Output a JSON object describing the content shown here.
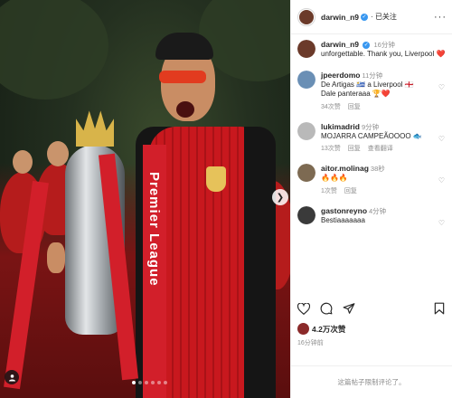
{
  "post": {
    "username": "darwin_n9",
    "follow_status": "已关注",
    "caption_time": "16分钟",
    "caption_text": "unforgettable. Thank you, Liverpool ❤️",
    "more_icon": "ellipsis-icon"
  },
  "photo": {
    "ribbon_text": "Premier League",
    "next_icon": "chevron-right-icon",
    "carousel_count": 6,
    "carousel_active": 0
  },
  "comments": [
    {
      "user": "jpeerdomo",
      "time": "11分钟",
      "text": "De Artigas 🇺🇾 a Liverpool 🏴󠁧󠁢󠁥󠁮󠁧󠁿",
      "text2": "Dale panteraaa 🏆❤️",
      "likes": "34次赞",
      "reply": "回复",
      "translate": "",
      "avatar_color": "#6a8fb5"
    },
    {
      "user": "lukimadrid",
      "time": "9分钟",
      "text": "MOJARRA CAMPEÃOOOO 🐟",
      "text2": "",
      "likes": "13次赞",
      "reply": "回复",
      "translate": "查看翻译",
      "avatar_color": "#b9b9b9"
    },
    {
      "user": "aitor.molinag",
      "time": "38秒",
      "text": "🔥🔥🔥",
      "text2": "",
      "likes": "1次赞",
      "reply": "回复",
      "translate": "",
      "avatar_color": "#7d6a52"
    },
    {
      "user": "gastonreyno",
      "time": "4分钟",
      "text": "Bestiaaaaaaa",
      "text2": "",
      "likes": "",
      "reply": "",
      "translate": "",
      "avatar_color": "#3a3a3a"
    }
  ],
  "actions": {
    "like_icon": "heart-icon",
    "comment_icon": "comment-icon",
    "share_icon": "send-icon",
    "save_icon": "bookmark-icon"
  },
  "likes_count": "4.2万次赞",
  "posted_time": "16分钟前",
  "comments_limited": "这篇帖子限制评论了。",
  "colors": {
    "verified": "#3897f0",
    "secondary_text": "#8e8e8e",
    "liverpool_red": "#c8181e"
  }
}
